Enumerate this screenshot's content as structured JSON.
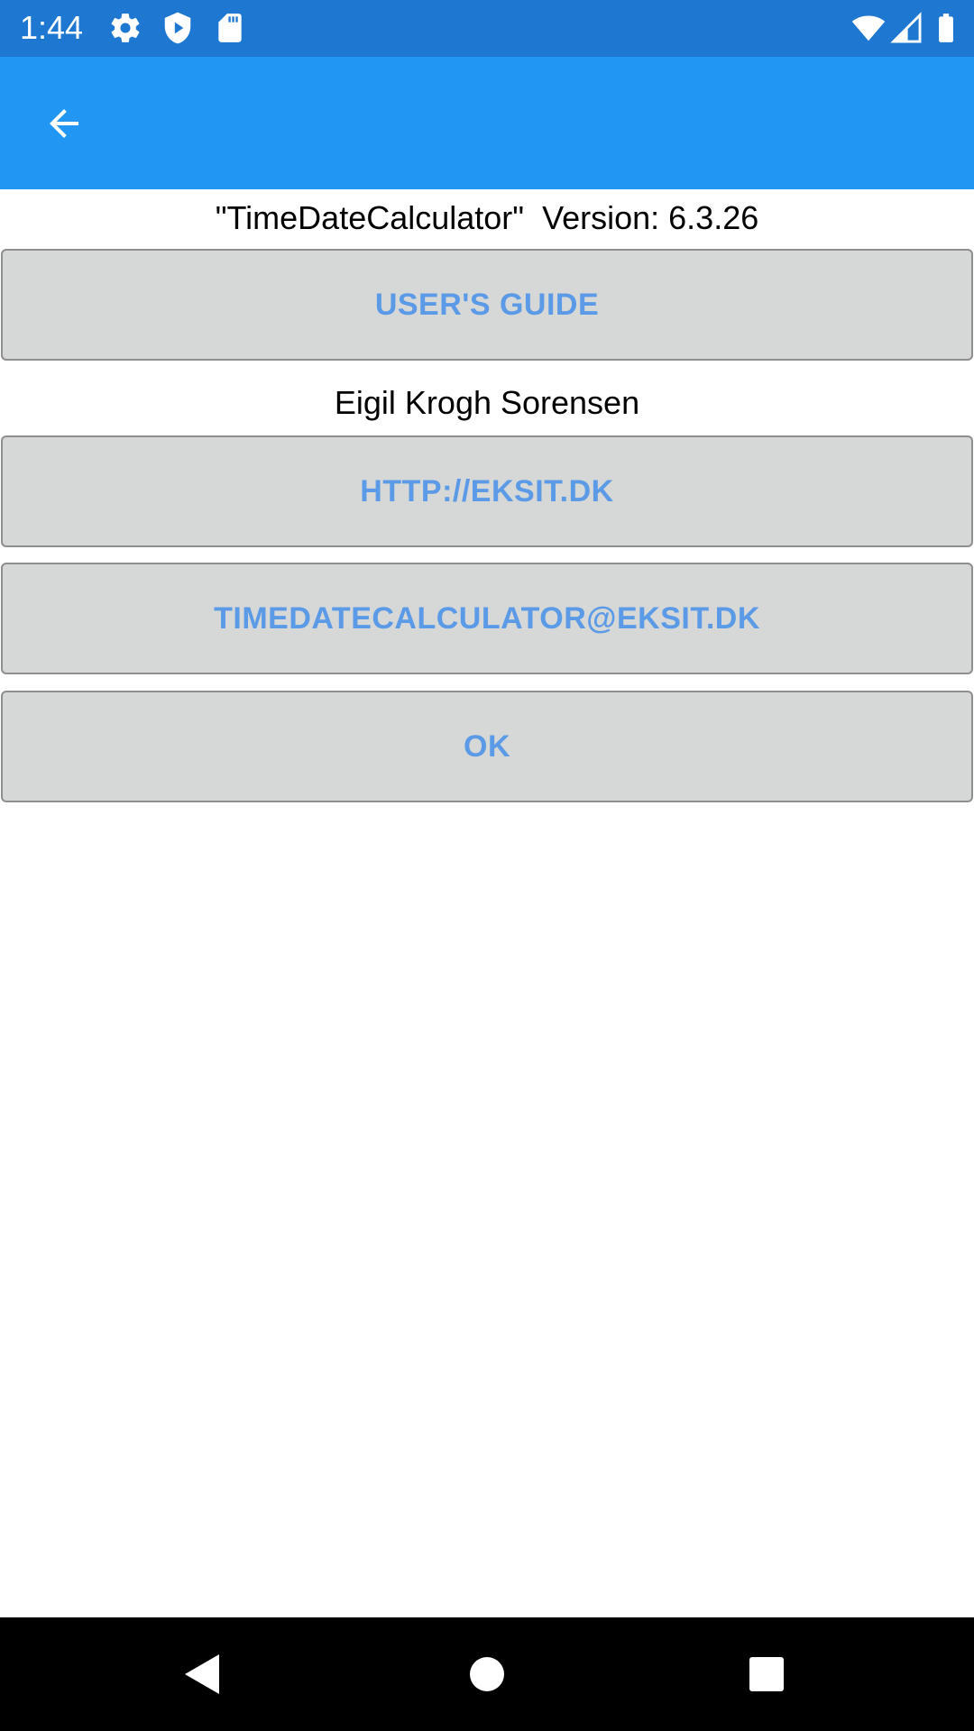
{
  "status_bar": {
    "time": "1:44",
    "background_color": "#1e78d2",
    "icons_left": [
      "gear-icon",
      "shield-play-icon",
      "sd-card-icon"
    ],
    "icons_right": [
      "wifi-icon",
      "cell-signal-icon",
      "battery-icon"
    ]
  },
  "app_bar": {
    "background_color": "#2296f3",
    "back_icon": "arrow-left-icon"
  },
  "about": {
    "version_text": "\"TimeDateCalculator\"  Version: 6.3.26",
    "users_guide_label": "USER'S GUIDE",
    "author": "Eigil Krogh Sorensen",
    "website_label": "HTTP://EKSIT.DK",
    "email_label": "TIMEDATECALCULATOR@EKSIT.DK",
    "ok_label": "OK",
    "button_background": "#d6d7d7",
    "button_text_color": "#5a9ae6"
  },
  "nav_bar": {
    "buttons": [
      "back-triangle-icon",
      "home-circle-icon",
      "recents-square-icon"
    ]
  }
}
